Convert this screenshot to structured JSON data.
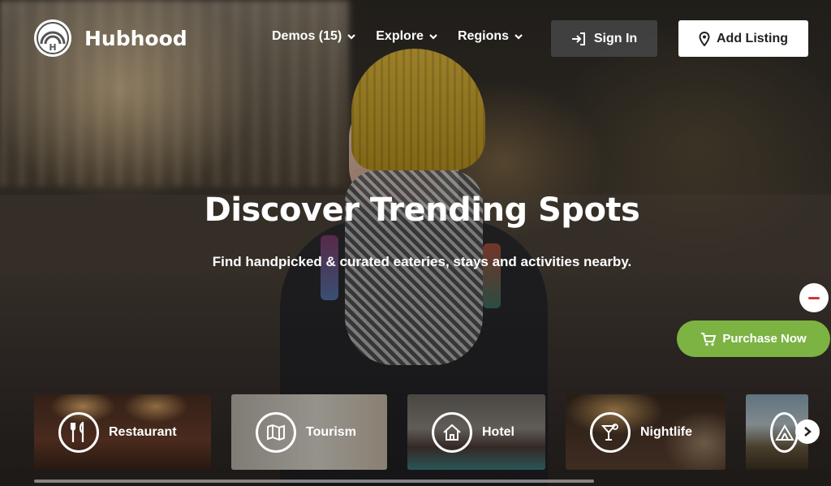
{
  "brand": {
    "name": "Hubhood",
    "logo_letter": "H"
  },
  "nav": {
    "items": [
      {
        "label": "Demos (15)"
      },
      {
        "label": "Explore"
      },
      {
        "label": "Regions"
      }
    ],
    "signin_label": "Sign In",
    "add_listing_label": "Add Listing"
  },
  "hero": {
    "title": "Discover Trending Spots",
    "subtitle": "Find handpicked & curated eateries, stays and activities nearby."
  },
  "floating": {
    "purchase_label": "Purchase Now"
  },
  "categories": [
    {
      "label": "Restaurant",
      "icon": "fork-knife-icon"
    },
    {
      "label": "Tourism",
      "icon": "map-icon"
    },
    {
      "label": "Hotel",
      "icon": "home-icon"
    },
    {
      "label": "Nightlife",
      "icon": "cocktail-icon"
    },
    {
      "label": "",
      "icon": "tent-icon"
    }
  ],
  "colors": {
    "accent_green": "#7cb342",
    "minus_red": "#d4343a",
    "signin_bg": "#464648"
  }
}
